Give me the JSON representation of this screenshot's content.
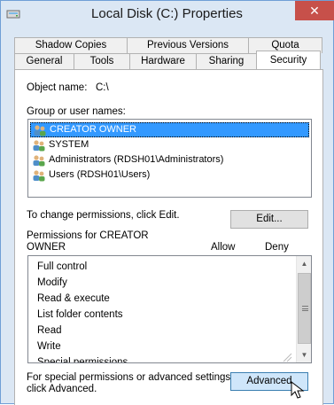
{
  "window": {
    "title": "Local Disk (C:) Properties",
    "close_glyph": "✕"
  },
  "tabs": {
    "row1": [
      "Shadow Copies",
      "Previous Versions",
      "Quota"
    ],
    "row2": [
      "General",
      "Tools",
      "Hardware",
      "Sharing",
      "Security"
    ],
    "active": "Security"
  },
  "security": {
    "object_name_label": "Object name:",
    "object_name_value": "C:\\",
    "group_label": "Group or user names:",
    "users": [
      {
        "name": "CREATOR OWNER",
        "selected": true
      },
      {
        "name": "SYSTEM",
        "selected": false
      },
      {
        "name": "Administrators (RDSH01\\Administrators)",
        "selected": false
      },
      {
        "name": "Users (RDSH01\\Users)",
        "selected": false
      }
    ],
    "change_text": "To change permissions, click Edit.",
    "edit_button": "Edit...",
    "perm_label_line1": "Permissions for CREATOR",
    "perm_label_line2": "OWNER",
    "allow_header": "Allow",
    "deny_header": "Deny",
    "permissions": [
      "Full control",
      "Modify",
      "Read & execute",
      "List folder contents",
      "Read",
      "Write",
      "Special permissions"
    ],
    "special_line1": "For special permissions or advanced settings,",
    "special_line2": "click Advanced.",
    "advanced_button": "Advanced"
  },
  "colors": {
    "title_bg": "#dbe7f4",
    "close_bg": "#c7504a",
    "selection": "#3399ff"
  }
}
